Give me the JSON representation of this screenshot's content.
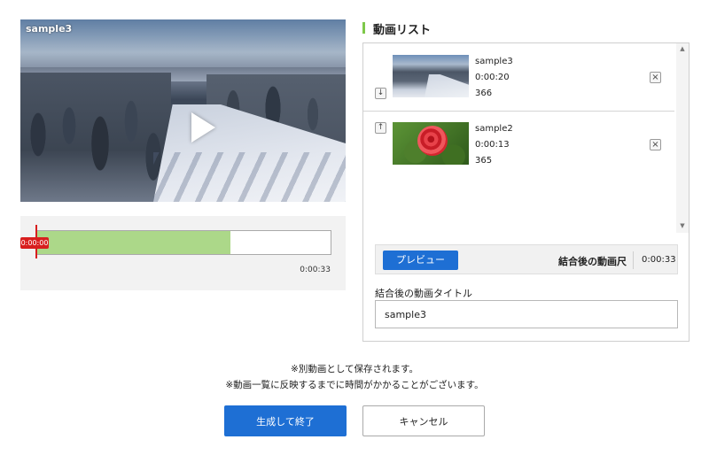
{
  "player": {
    "title": "sample3",
    "play_icon": "play-icon"
  },
  "timeline": {
    "current_time": "0:00:00",
    "duration": "0:00:33",
    "fill_fraction": 0.66
  },
  "video_list": {
    "title": "動画リスト",
    "accent_color": "#7ec84a",
    "items": [
      {
        "name": "sample3",
        "duration": "0:00:20",
        "id": "366",
        "move_icon": "arrow-down-icon",
        "move_symbol": "↓",
        "remove_icon": "close-icon"
      },
      {
        "name": "sample2",
        "duration": "0:00:13",
        "id": "365",
        "move_icon": "arrow-up-icon",
        "move_symbol": "↑",
        "remove_icon": "close-icon"
      }
    ]
  },
  "preview": {
    "button_label": "プレビュー",
    "combined_label": "結合後の動画尺",
    "combined_value": "0:00:33"
  },
  "title_field": {
    "label": "結合後の動画タイトル",
    "value": "sample3"
  },
  "notes": {
    "line1": "※別動画として保存されます。",
    "line2": "※動画一覧に反映するまでに時間がかかることがございます。"
  },
  "actions": {
    "finish_label": "生成して終了",
    "cancel_label": "キャンセル",
    "primary_color": "#1e6fd4"
  }
}
